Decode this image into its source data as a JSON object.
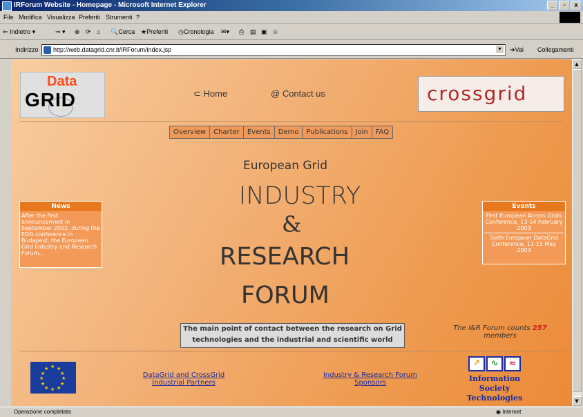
{
  "window": {
    "title": "IRForum Website - Homepage - Microsoft Internet Explorer",
    "controls": [
      "_",
      "▫",
      "x"
    ]
  },
  "menu": [
    "File",
    "Modifica",
    "Visualizza",
    "Preferiti",
    "Strumenti",
    "?"
  ],
  "toolbar": {
    "back": "Indietro",
    "search": "Cerca",
    "favorites": "Preferiti",
    "history": "Cronologia"
  },
  "address": {
    "label": "Indirizzo",
    "url": "http://web.datagrid.cnr.it/IRForum/index.jsp",
    "go": "Vai",
    "links": "Collegamenti"
  },
  "status": {
    "text": "Operazione completata",
    "zone": "Internet"
  },
  "page": {
    "datagrid_logo": {
      "data": "Data",
      "grid": "GRID"
    },
    "nav_home": "Home",
    "nav_contact": "Contact us",
    "crossgrid_logo": "crossgrid",
    "navbar": [
      "Overview",
      "Charter",
      "Events",
      "Demo",
      "Publications",
      "Join",
      "FAQ"
    ],
    "title_line1": "European Grid",
    "title_line2": "INDUSTRY",
    "title_line3": "&",
    "title_line4": "RESEARCH",
    "title_line5": "FORUM",
    "news": {
      "heading": "News",
      "body": "After the first announcement in September 2002, during the EDG conference in Budapest, the European Grid Industry and Research Forum..."
    },
    "events": {
      "heading": "Events",
      "item1": "First European Across Grids Conference, 13-14 February 2003",
      "item2": "Sixth European DataGrid Conference, 11-15 May 2003"
    },
    "main_contact": "The main point of contact between the research on Grid technologies and the industrial and scientific world",
    "counts_prefix": "The I&R Forum counts",
    "counts_number": "257",
    "counts_suffix": "members",
    "link_partners": "DataGrid and CrossGrid Industrial Partners",
    "link_sponsors": "Industry & Research Forum Sponsors",
    "ist_logo": {
      "line1": "Information Society",
      "line2": "Technologies"
    }
  },
  "colors": {
    "page_bg": "#ef9c52",
    "panel_header": "#e8781e",
    "link": "#1a2aa0",
    "count_number": "#d02020"
  }
}
